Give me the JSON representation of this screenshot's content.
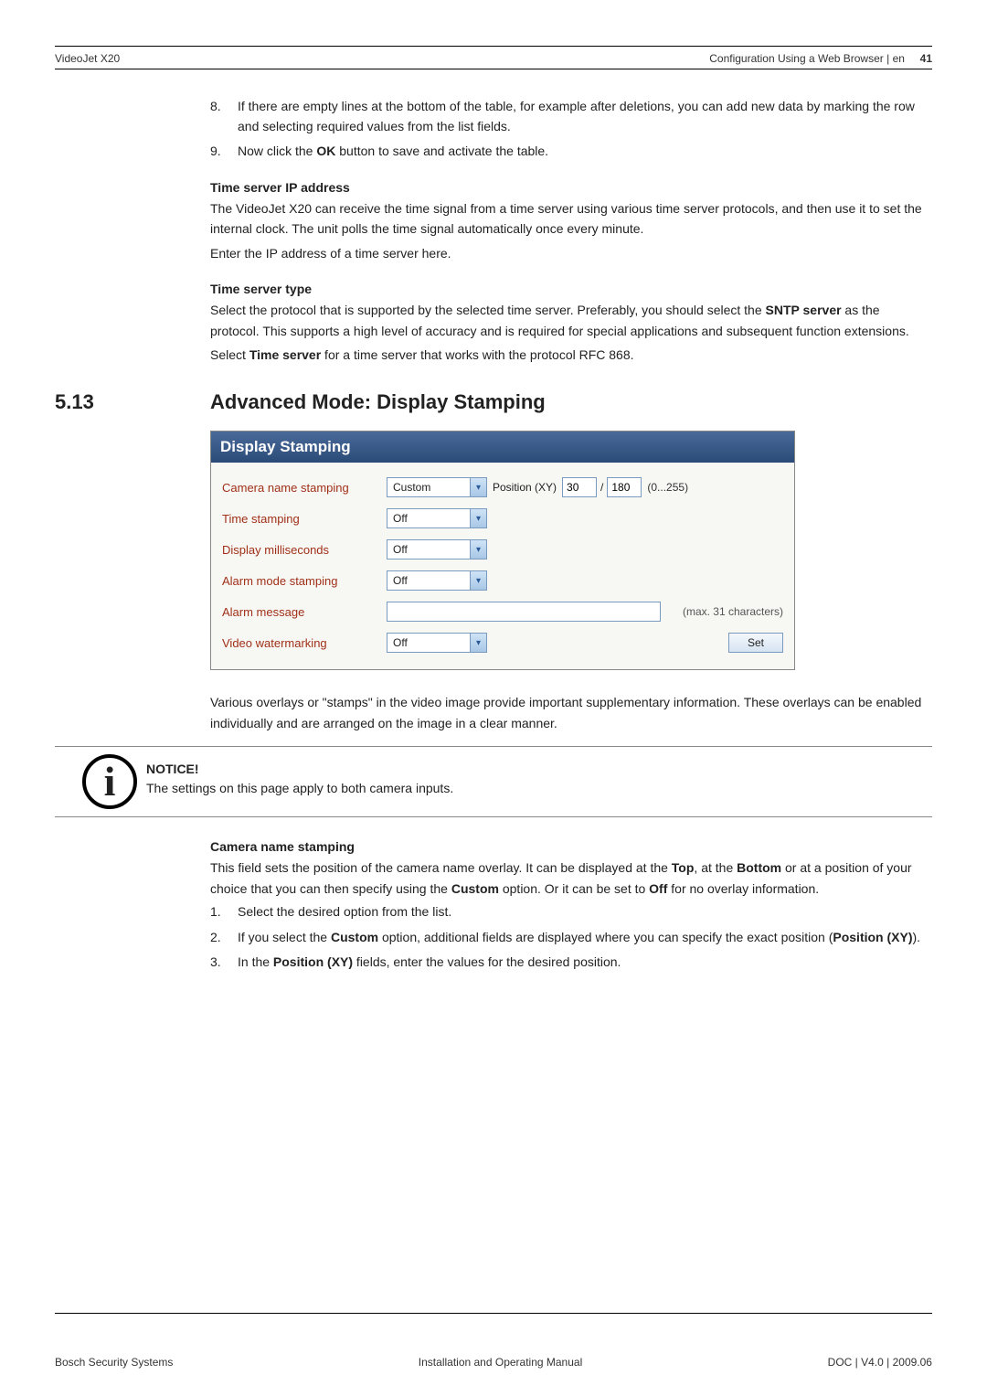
{
  "header": {
    "left": "VideoJet X20",
    "right_section": "Configuration Using a Web Browser",
    "right_lang": "en",
    "page_num": "41"
  },
  "intro_list": {
    "item8_num": "8.",
    "item8_text": "If there are empty lines at the bottom of the table, for example after deletions, you can add new data by marking the row and selecting required values from the list fields.",
    "item9_num": "9.",
    "item9_pre": "Now click the ",
    "item9_bold": "OK",
    "item9_post": " button to save and activate the table."
  },
  "sec_ip": {
    "heading": "Time server IP address",
    "p1": "The VideoJet X20 can receive the time signal from a time server using various time server protocols, and then use it to set the internal clock. The unit polls the time signal automatically once every minute.",
    "p2": "Enter the IP address of a time server here."
  },
  "sec_type": {
    "heading": "Time server type",
    "p1a": "Select the protocol that is supported by the selected time server. Preferably, you should select the ",
    "p1b": "SNTP server",
    "p1c": " as the protocol. This supports a high level of accuracy and is required for special applications and subsequent function extensions.",
    "p2a": "Select ",
    "p2b": "Time server",
    "p2c": " for a time server that works with the protocol RFC 868."
  },
  "section": {
    "num": "5.13",
    "title": "Advanced Mode: Display Stamping"
  },
  "panel": {
    "title": "Display Stamping",
    "rows": {
      "camera_label": "Camera name stamping",
      "camera_value": "Custom",
      "pos_label": "Position (XY)",
      "pos_x": "30",
      "pos_y": "180",
      "pos_range": "(0...255)",
      "time_label": "Time stamping",
      "time_value": "Off",
      "ms_label": "Display milliseconds",
      "ms_value": "Off",
      "alarm_label": "Alarm mode stamping",
      "alarm_value": "Off",
      "msg_label": "Alarm message",
      "msg_value": "",
      "msg_note": "(max. 31 characters)",
      "water_label": "Video watermarking",
      "water_value": "Off",
      "set_btn": "Set"
    }
  },
  "after_panel": {
    "p": "Various overlays or \"stamps\" in the video image provide important supplementary information. These overlays can be enabled individually and are arranged on the image in a clear manner."
  },
  "notice": {
    "title": "NOTICE!",
    "text": "The settings on this page apply to both camera inputs."
  },
  "cam_stamp": {
    "heading": "Camera name stamping",
    "p_a": "This field sets the position of the camera name overlay. It can be displayed at the ",
    "p_b": "Top",
    "p_c": ", at the ",
    "p_d": "Bottom",
    "p_e": " or at a position of your choice that you can then specify using the ",
    "p_f": "Custom",
    "p_g": " option. Or it can be set to ",
    "p_h": "Off",
    "p_i": " for no overlay information.",
    "li1_num": "1.",
    "li1": "Select the desired option from the list.",
    "li2_num": "2.",
    "li2_a": "If you select the ",
    "li2_b": "Custom",
    "li2_c": " option, additional fields are displayed where you can specify the exact position (",
    "li2_d": "Position (XY)",
    "li2_e": ").",
    "li3_num": "3.",
    "li3_a": "In the ",
    "li3_b": "Position (XY)",
    "li3_c": " fields, enter the values for the desired position."
  },
  "footer": {
    "left": "Bosch Security Systems",
    "center": "Installation and Operating Manual",
    "right": "DOC | V4.0 | 2009.06"
  }
}
